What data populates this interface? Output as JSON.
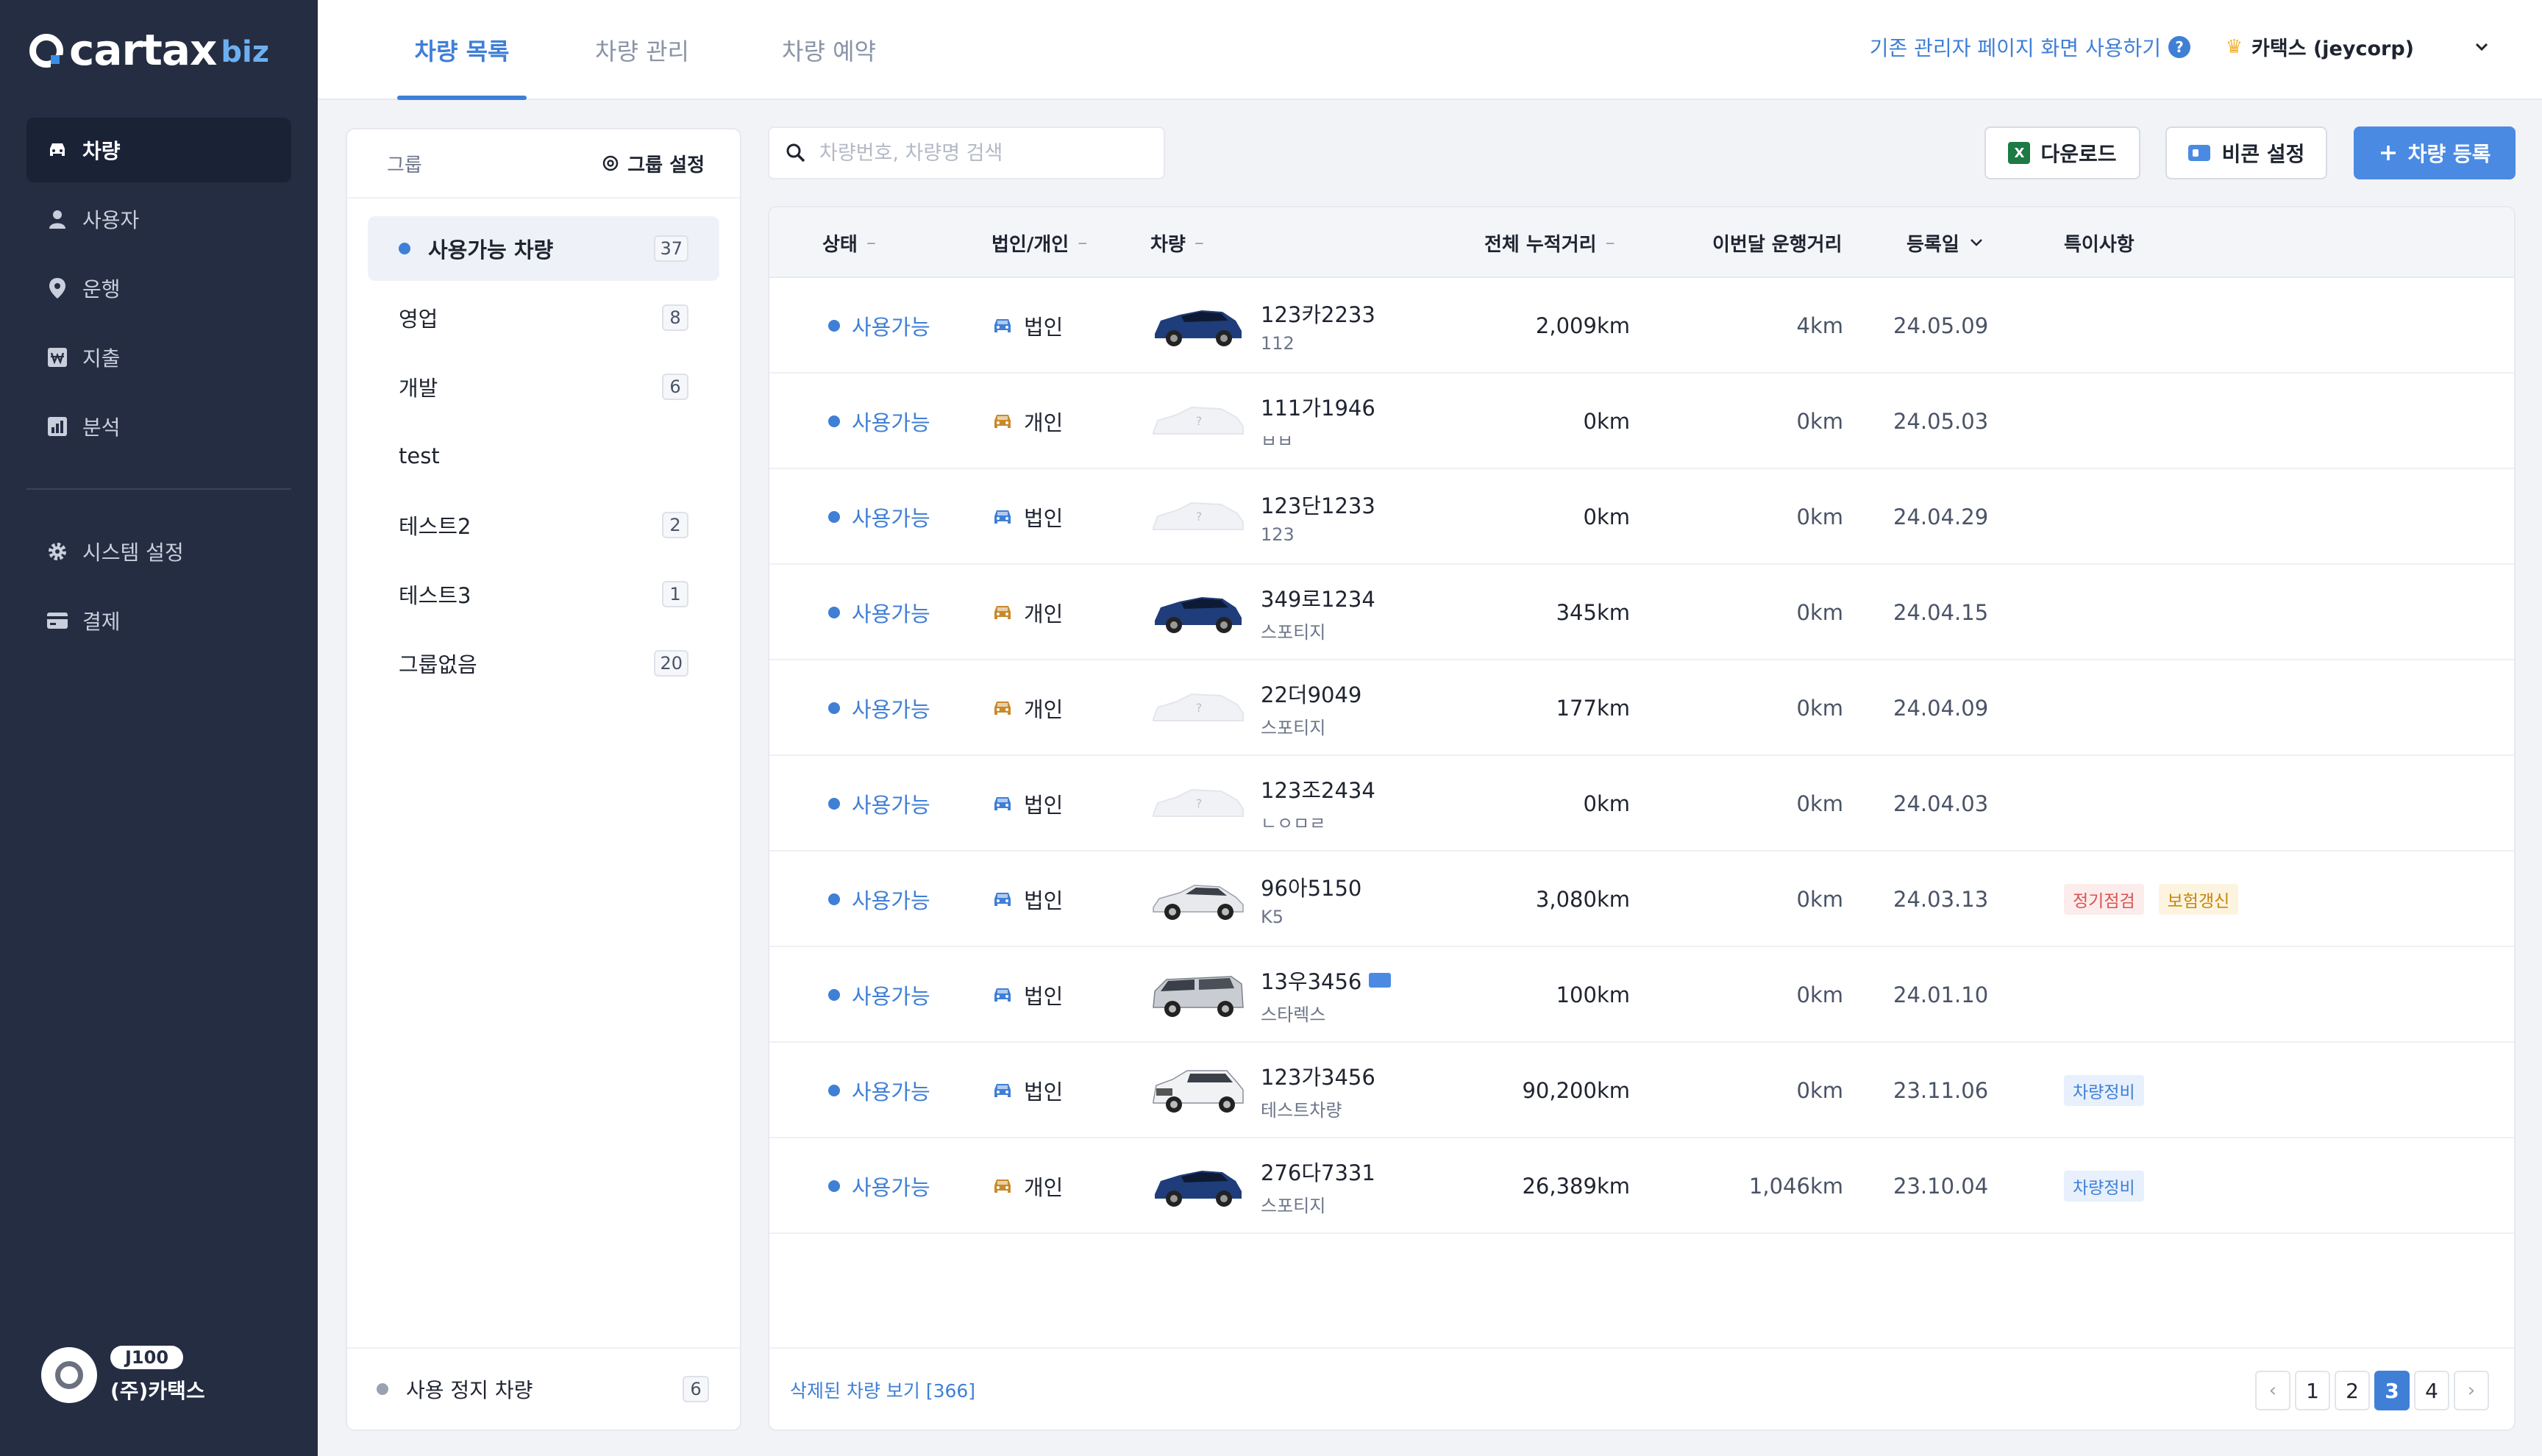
{
  "brand": {
    "name": "cartax",
    "suffix": "biz"
  },
  "sidebar": {
    "items": [
      {
        "label": "차량",
        "icon": "car-icon",
        "active": true
      },
      {
        "label": "사용자",
        "icon": "user-icon"
      },
      {
        "label": "운행",
        "icon": "location-pin-icon"
      },
      {
        "label": "지출",
        "icon": "won-icon"
      },
      {
        "label": "분석",
        "icon": "chart-icon"
      }
    ],
    "bottom_items": [
      {
        "label": "시스템 설정",
        "icon": "gear-icon"
      },
      {
        "label": "결제",
        "icon": "card-icon"
      }
    ],
    "user": {
      "tier": "J100",
      "company": "(주)카택스"
    }
  },
  "header": {
    "tabs": [
      {
        "label": "차량 목록",
        "active": true
      },
      {
        "label": "차량 관리"
      },
      {
        "label": "차량 예약"
      }
    ],
    "admin_link": "기존 관리자 페이지 화면 사용하기",
    "help": "?",
    "account": "카택스 (jeycorp)"
  },
  "groups": {
    "title": "그룹",
    "settings_label": "그룹 설정",
    "items": [
      {
        "label": "사용가능 차량",
        "count": "37",
        "active": true
      },
      {
        "label": "영업",
        "count": "8"
      },
      {
        "label": "개발",
        "count": "6"
      },
      {
        "label": "test",
        "count": ""
      },
      {
        "label": "테스트2",
        "count": "2"
      },
      {
        "label": "테스트3",
        "count": "1"
      },
      {
        "label": "그룹없음",
        "count": "20"
      }
    ],
    "footer": {
      "label": "사용 정지 차량",
      "count": "6"
    }
  },
  "toolbar": {
    "search_placeholder": "차량번호, 차량명 검색",
    "download_label": "다운로드",
    "beacon_label": "비콘 설정",
    "register_label": "차량 등록"
  },
  "table": {
    "columns": {
      "status": "상태",
      "owner": "법인/개인",
      "vehicle": "차량",
      "total_distance": "전체 누적거리",
      "month_distance": "이번달 운행거리",
      "registered": "등록일",
      "notes": "특이사항"
    },
    "rows": [
      {
        "status": "사용가능",
        "owner": "법인",
        "owner_type": "corp",
        "plate": "123카2233",
        "model": "112",
        "image": "blue-suv",
        "total": "2,009km",
        "month": "4km",
        "date": "24.05.09",
        "tags": []
      },
      {
        "status": "사용가능",
        "owner": "개인",
        "owner_type": "personal",
        "plate": "111가1946",
        "model": "ㅂㅂ",
        "image": "placeholder",
        "total": "0km",
        "month": "0km",
        "date": "24.05.03",
        "tags": []
      },
      {
        "status": "사용가능",
        "owner": "법인",
        "owner_type": "corp",
        "plate": "123단1233",
        "model": "123",
        "image": "placeholder",
        "total": "0km",
        "month": "0km",
        "date": "24.04.29",
        "tags": []
      },
      {
        "status": "사용가능",
        "owner": "개인",
        "owner_type": "personal",
        "plate": "349로1234",
        "model": "스포티지",
        "image": "blue-suv",
        "total": "345km",
        "month": "0km",
        "date": "24.04.15",
        "tags": []
      },
      {
        "status": "사용가능",
        "owner": "개인",
        "owner_type": "personal",
        "plate": "22더9049",
        "model": "스포티지",
        "image": "placeholder",
        "total": "177km",
        "month": "0km",
        "date": "24.04.09",
        "tags": []
      },
      {
        "status": "사용가능",
        "owner": "법인",
        "owner_type": "corp",
        "plate": "123조2434",
        "model": "ㄴㅇㅁㄹ",
        "image": "placeholder",
        "total": "0km",
        "month": "0km",
        "date": "24.04.03",
        "tags": []
      },
      {
        "status": "사용가능",
        "owner": "법인",
        "owner_type": "corp",
        "plate": "96아5150",
        "model": "K5",
        "image": "white-sedan",
        "total": "3,080km",
        "month": "0km",
        "date": "24.03.13",
        "tags": [
          {
            "label": "정기점검",
            "color": "red"
          },
          {
            "label": "보험갱신",
            "color": "yellow"
          }
        ]
      },
      {
        "status": "사용가능",
        "owner": "법인",
        "owner_type": "corp",
        "plate": "13우3456",
        "model": "스타렉스",
        "image": "silver-van",
        "beacon": true,
        "total": "100km",
        "month": "0km",
        "date": "24.01.10",
        "tags": []
      },
      {
        "status": "사용가능",
        "owner": "법인",
        "owner_type": "corp",
        "plate": "123가3456",
        "model": "테스트차량",
        "image": "white-suv",
        "total": "90,200km",
        "month": "0km",
        "date": "23.11.06",
        "tags": [
          {
            "label": "차량정비",
            "color": "blue"
          }
        ]
      },
      {
        "status": "사용가능",
        "owner": "개인",
        "owner_type": "personal",
        "plate": "276다7331",
        "model": "스포티지",
        "image": "blue-suv",
        "total": "26,389km",
        "month": "1,046km",
        "date": "23.10.04",
        "tags": [
          {
            "label": "차량정비",
            "color": "blue"
          }
        ]
      }
    ],
    "deleted_link": "삭제된 차량 보기 [366]",
    "pagination": {
      "pages": [
        "1",
        "2",
        "3",
        "4"
      ],
      "current": "3",
      "prev": "‹",
      "next": "›"
    }
  },
  "colors": {
    "accent": "#3f7fd6",
    "sidebar_bg": "#252d43",
    "corp_icon": "#3f7fd6",
    "personal_icon": "#c88a2c"
  }
}
